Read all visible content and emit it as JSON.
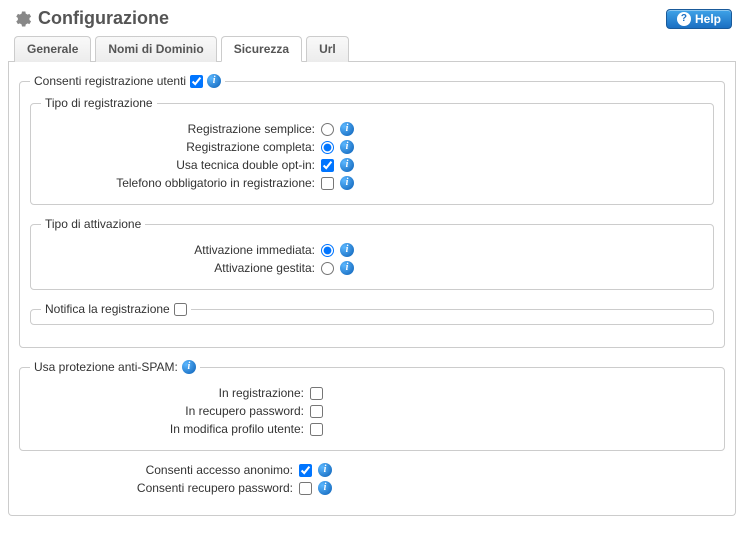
{
  "header": {
    "title": "Configurazione",
    "help_label": "Help"
  },
  "tabs": [
    {
      "label": "Generale"
    },
    {
      "label": "Nomi di Dominio"
    },
    {
      "label": "Sicurezza"
    },
    {
      "label": "Url"
    }
  ],
  "fs_consenti": {
    "legend": "Consenti registrazione utenti",
    "checked": true
  },
  "fs_tipo_reg": {
    "legend": "Tipo di registrazione",
    "rows": [
      {
        "label": "Registrazione semplice:",
        "type": "radio",
        "checked": false
      },
      {
        "label": "Registrazione completa:",
        "type": "radio",
        "checked": true
      },
      {
        "label": "Usa tecnica double opt-in:",
        "type": "checkbox",
        "checked": true
      },
      {
        "label": "Telefono obbligatorio in registrazione:",
        "type": "checkbox",
        "checked": false
      }
    ]
  },
  "fs_tipo_att": {
    "legend": "Tipo di attivazione",
    "rows": [
      {
        "label": "Attivazione immediata:",
        "type": "radio",
        "checked": true
      },
      {
        "label": "Attivazione gestita:",
        "type": "radio",
        "checked": false
      }
    ]
  },
  "fs_notifica": {
    "legend": "Notifica la registrazione",
    "checked": false
  },
  "fs_antispam": {
    "legend": "Usa protezione anti-SPAM:",
    "rows": [
      {
        "label": "In registrazione:",
        "checked": false
      },
      {
        "label": "In recupero password:",
        "checked": false
      },
      {
        "label": "In modifica profilo utente:",
        "checked": false
      }
    ]
  },
  "bottom": [
    {
      "label": "Consenti accesso anonimo:",
      "checked": true
    },
    {
      "label": "Consenti recupero password:",
      "checked": false
    }
  ]
}
